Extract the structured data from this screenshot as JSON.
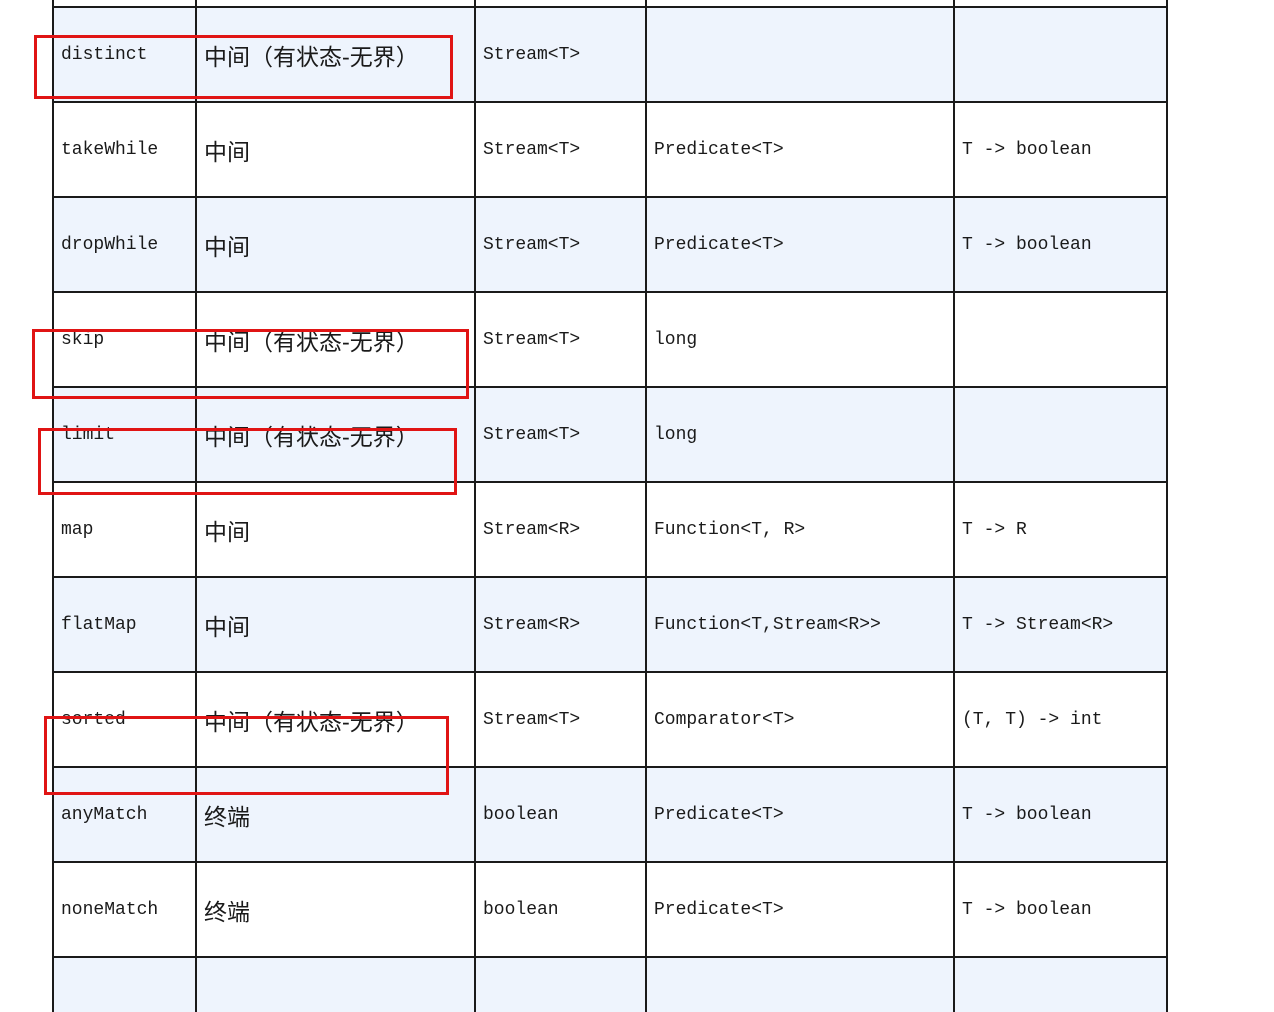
{
  "table": {
    "rows": [
      {
        "op": "",
        "type": "",
        "ret": "",
        "arg": "",
        "desc": "",
        "highlighted": false
      },
      {
        "op": "distinct",
        "type": "中间（有状态-无界）",
        "ret": "Stream<T>",
        "arg": "",
        "desc": "",
        "highlighted": true
      },
      {
        "op": "takeWhile",
        "type": "中间",
        "ret": "Stream<T>",
        "arg": "Predicate<T>",
        "desc": "T -> boolean",
        "highlighted": false
      },
      {
        "op": "dropWhile",
        "type": "中间",
        "ret": "Stream<T>",
        "arg": "Predicate<T>",
        "desc": "T -> boolean",
        "highlighted": false
      },
      {
        "op": "skip",
        "type": "中间（有状态-无界）",
        "ret": "Stream<T>",
        "arg": "long",
        "desc": "",
        "highlighted": true
      },
      {
        "op": "limit",
        "type": "中间（有状态-无界）",
        "ret": "Stream<T>",
        "arg": "long",
        "desc": "",
        "highlighted": true
      },
      {
        "op": "map",
        "type": "中间",
        "ret": "Stream<R>",
        "arg": "Function<T, R>",
        "desc": "T -> R",
        "highlighted": false
      },
      {
        "op": "flatMap",
        "type": "中间",
        "ret": "Stream<R>",
        "arg": "Function<T,Stream<R>>",
        "desc": "T -> Stream<R>",
        "highlighted": false
      },
      {
        "op": "sorted",
        "type": "中间（有状态-无界）",
        "ret": "Stream<T>",
        "arg": "Comparator<T>",
        "desc": "(T, T) -> int",
        "highlighted": true
      },
      {
        "op": "anyMatch",
        "type": "终端",
        "ret": "boolean",
        "arg": "Predicate<T>",
        "desc": "T -> boolean",
        "highlighted": false
      },
      {
        "op": "noneMatch",
        "type": "终端",
        "ret": "boolean",
        "arg": "Predicate<T>",
        "desc": "T -> boolean",
        "highlighted": false
      },
      {
        "op": "",
        "type": "",
        "ret": "",
        "arg": "",
        "desc": "",
        "highlighted": false
      }
    ]
  },
  "colors": {
    "row_shade": "#eef4fd",
    "row_plain": "#ffffff",
    "border": "#1a1a1a",
    "highlight_box": "#e01414"
  }
}
